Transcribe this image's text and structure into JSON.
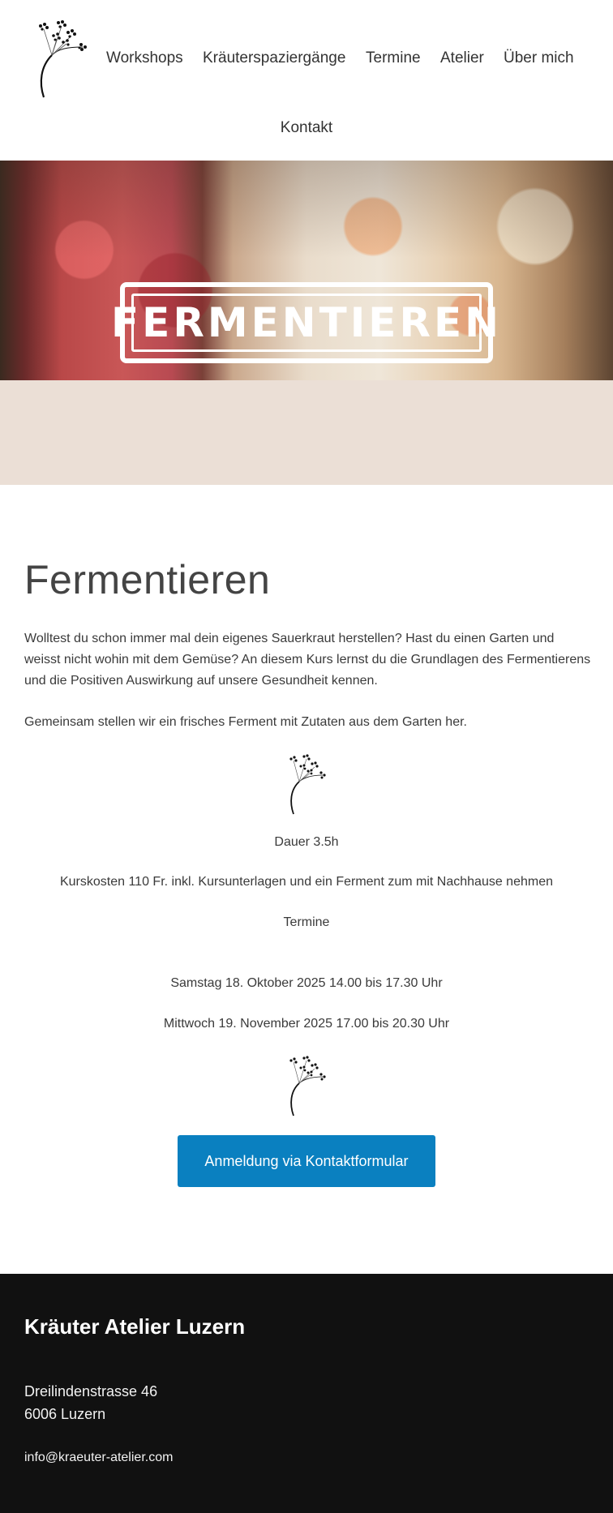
{
  "nav": {
    "items": [
      "Workshops",
      "Kräuterspaziergänge",
      "Termine",
      "Atelier",
      "Über mich"
    ],
    "contact": "Kontakt"
  },
  "hero": {
    "badge_text": "FERMENTIEREN"
  },
  "main": {
    "title": "Fermentieren",
    "intro": "Wolltest du schon immer mal dein eigenes Sauerkraut herstellen? Hast du einen Garten und weisst nicht wohin mit dem Gemüse? An diesem Kurs lernst du die Grundlagen des Fermentierens und die Positiven Auswirkung auf unsere Gesundheit kennen.",
    "together": "Gemeinsam stellen wir ein frisches Ferment mit Zutaten aus dem Garten her.",
    "duration": "Dauer 3.5h",
    "cost": "Kurskosten 110 Fr. inkl. Kursunterlagen und ein Ferment zum mit Nachhause nehmen",
    "dates_heading": "Termine",
    "dates": [
      "Samstag 18. Oktober 2025 14.00 bis 17.30 Uhr",
      "Mittwoch 19. November 2025 17.00 bis 20.30 Uhr"
    ],
    "button_label": "Anmeldung via Kontaktformular"
  },
  "footer": {
    "title": "Kräuter Atelier Luzern",
    "street": "Dreilindenstrasse 46",
    "city": "6006 Luzern",
    "email": "info@kraeuter-atelier.com"
  },
  "colors": {
    "button": "#0a80c0",
    "beige_band": "#ebdfd6",
    "footer_bg": "#111111"
  },
  "icons": [
    "umbel-flower-logo-icon",
    "umbel-flower-divider-icon"
  ]
}
